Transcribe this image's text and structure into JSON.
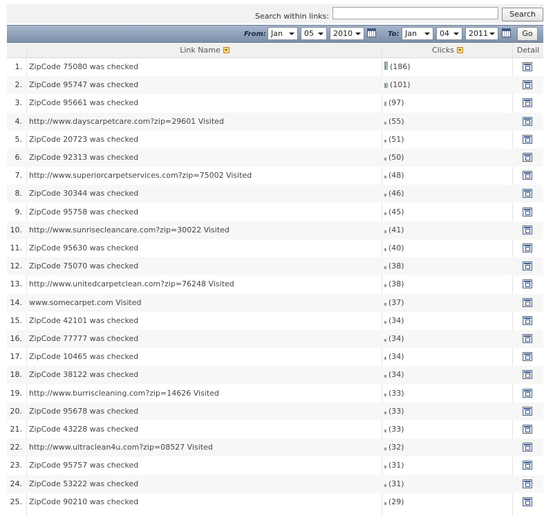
{
  "search": {
    "label": "Search within links:",
    "value": "",
    "placeholder": "",
    "button": "Search"
  },
  "datebar": {
    "from_label": "From:",
    "from": {
      "month": "Jan",
      "day": "05",
      "year": "2010"
    },
    "to_label": "To:",
    "to": {
      "month": "Jan",
      "day": "04",
      "year": "2011"
    },
    "go": "Go"
  },
  "table": {
    "headers": {
      "name": "Link Name",
      "clicks": "Clicks",
      "detail": "Detail"
    },
    "max_clicks": 186,
    "rows": [
      {
        "num": "1.",
        "name": "ZipCode 75080 was checked",
        "clicks": 186,
        "clicks_text": "(186)"
      },
      {
        "num": "2.",
        "name": "ZipCode 95747 was checked",
        "clicks": 101,
        "clicks_text": "(101)"
      },
      {
        "num": "3.",
        "name": "ZipCode 95661 was checked",
        "clicks": 97,
        "clicks_text": "(97)"
      },
      {
        "num": "4.",
        "name": "http://www.dayscarpetcare.com?zip=29601 Visited",
        "clicks": 55,
        "clicks_text": "(55)"
      },
      {
        "num": "5.",
        "name": "ZipCode 20723 was checked",
        "clicks": 51,
        "clicks_text": "(51)"
      },
      {
        "num": "6.",
        "name": "ZipCode 92313 was checked",
        "clicks": 50,
        "clicks_text": "(50)"
      },
      {
        "num": "7.",
        "name": "http://www.superiorcarpetservices.com?zip=75002 Visited",
        "clicks": 48,
        "clicks_text": "(48)"
      },
      {
        "num": "8.",
        "name": "ZipCode 30344 was checked",
        "clicks": 46,
        "clicks_text": "(46)"
      },
      {
        "num": "9.",
        "name": "ZipCode 95758 was checked",
        "clicks": 45,
        "clicks_text": "(45)"
      },
      {
        "num": "10.",
        "name": "http://www.sunrisecleancare.com?zip=30022 Visited",
        "clicks": 41,
        "clicks_text": "(41)"
      },
      {
        "num": "11.",
        "name": "ZipCode 95630 was checked",
        "clicks": 40,
        "clicks_text": "(40)"
      },
      {
        "num": "12.",
        "name": "ZipCode 75070 was checked",
        "clicks": 38,
        "clicks_text": "(38)"
      },
      {
        "num": "13.",
        "name": "http://www.unitedcarpetclean.com?zip=76248 Visited",
        "clicks": 38,
        "clicks_text": "(38)"
      },
      {
        "num": "14.",
        "name": "www.somecarpet.com Visited",
        "clicks": 37,
        "clicks_text": "(37)"
      },
      {
        "num": "15.",
        "name": "ZipCode 42101 was checked",
        "clicks": 34,
        "clicks_text": "(34)"
      },
      {
        "num": "16.",
        "name": "ZipCode 77777 was checked",
        "clicks": 34,
        "clicks_text": "(34)"
      },
      {
        "num": "17.",
        "name": "ZipCode 10465 was checked",
        "clicks": 34,
        "clicks_text": "(34)"
      },
      {
        "num": "18.",
        "name": "ZipCode 38122 was checked",
        "clicks": 34,
        "clicks_text": "(34)"
      },
      {
        "num": "19.",
        "name": "http://www.burriscleaning.com?zip=14626 Visited",
        "clicks": 33,
        "clicks_text": "(33)"
      },
      {
        "num": "20.",
        "name": "ZipCode 95678 was checked",
        "clicks": 33,
        "clicks_text": "(33)"
      },
      {
        "num": "21.",
        "name": "ZipCode 43228 was checked",
        "clicks": 33,
        "clicks_text": "(33)"
      },
      {
        "num": "22.",
        "name": "http://www.ultraclean4u.com?zip=08527 Visited",
        "clicks": 32,
        "clicks_text": "(32)"
      },
      {
        "num": "23.",
        "name": "ZipCode 95757 was checked",
        "clicks": 31,
        "clicks_text": "(31)"
      },
      {
        "num": "24.",
        "name": "ZipCode 53222 was checked",
        "clicks": 31,
        "clicks_text": "(31)"
      },
      {
        "num": "25.",
        "name": "ZipCode 90210 was checked",
        "clicks": 29,
        "clicks_text": "(29)"
      }
    ]
  },
  "colors": {
    "header_band": "#8fa0b8",
    "row_alt": "#f7f7f7"
  },
  "icons": {
    "sort": "sort-dropdown-icon",
    "calendar": "calendar-icon",
    "detail": "detail-report-icon"
  }
}
